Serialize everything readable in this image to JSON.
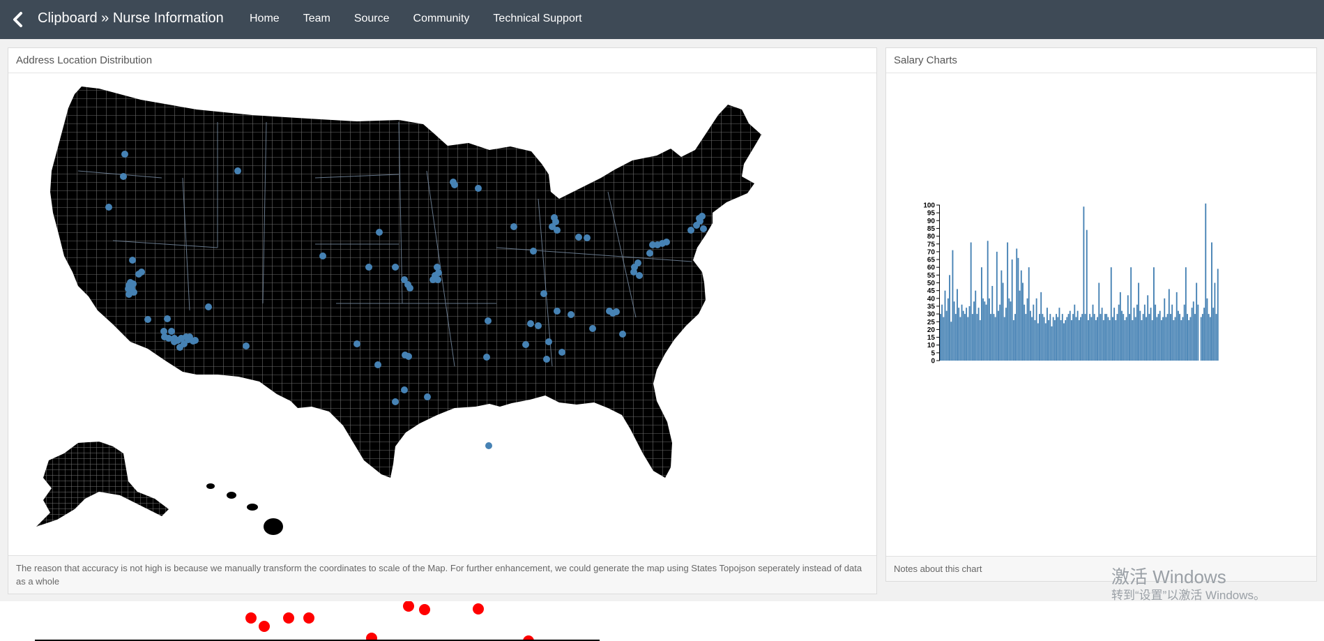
{
  "navbar": {
    "back_icon": "chevron-left-icon",
    "brand": "Clipboard » Nurse Information",
    "links": [
      {
        "label": "Home"
      },
      {
        "label": "Team"
      },
      {
        "label": "Source"
      },
      {
        "label": "Community"
      },
      {
        "label": "Technical Support"
      }
    ]
  },
  "map_panel": {
    "title": "Address Location Distribution",
    "footer": "The reason that accuracy is not high is because we manually transform the coordinates to scale of the Map. For further enhancement, we could generate the map using States Topojson seperately instead of data as a whole",
    "point_color": "#4682b4",
    "land_color": "#000000"
  },
  "salary_panel": {
    "title": "Salary Charts",
    "footer": "Notes about this chart"
  },
  "chart_data": {
    "type": "bar",
    "color": "#4682b4",
    "ylim": [
      0,
      100
    ],
    "yticks": [
      0,
      5,
      10,
      15,
      20,
      25,
      30,
      35,
      40,
      45,
      50,
      55,
      60,
      65,
      70,
      75,
      80,
      85,
      90,
      95,
      100
    ],
    "values": [
      30,
      36,
      28,
      45,
      32,
      40,
      55,
      25,
      71,
      38,
      30,
      46,
      34,
      28,
      36,
      32,
      30,
      34,
      28,
      35,
      76,
      30,
      38,
      45,
      30,
      34,
      26,
      60,
      40,
      38,
      36,
      77,
      40,
      30,
      48,
      30,
      28,
      70,
      32,
      36,
      58,
      50,
      28,
      34,
      76,
      40,
      38,
      65,
      26,
      30,
      72,
      66,
      45,
      58,
      50,
      36,
      30,
      40,
      60,
      32,
      28,
      36,
      26,
      40,
      24,
      30,
      44,
      30,
      28,
      24,
      34,
      26,
      30,
      22,
      28,
      26,
      30,
      28,
      34,
      26,
      30,
      24,
      26,
      28,
      30,
      32,
      26,
      30,
      36,
      28,
      32,
      26,
      28,
      30,
      99,
      30,
      84,
      26,
      30,
      28,
      36,
      30,
      26,
      28,
      50,
      30,
      34,
      26,
      30,
      30,
      28,
      26,
      60,
      28,
      34,
      26,
      30,
      36,
      44,
      32,
      30,
      26,
      28,
      42,
      30,
      60,
      26,
      34,
      28,
      36,
      50,
      32,
      26,
      30,
      36,
      28,
      42,
      30,
      34,
      26,
      60,
      36,
      28,
      30,
      32,
      26,
      28,
      40,
      28,
      30,
      46,
      30,
      36,
      26,
      28,
      44,
      32,
      30,
      26,
      28,
      36,
      60,
      30,
      26,
      28,
      34,
      38,
      30,
      50,
      36,
      0,
      28,
      30,
      34,
      101,
      40,
      30,
      28,
      76,
      34,
      50,
      30,
      59
    ]
  },
  "watermark": {
    "line1": "激活 Windows",
    "line2": "转到“设置”以激活 Windows。"
  }
}
